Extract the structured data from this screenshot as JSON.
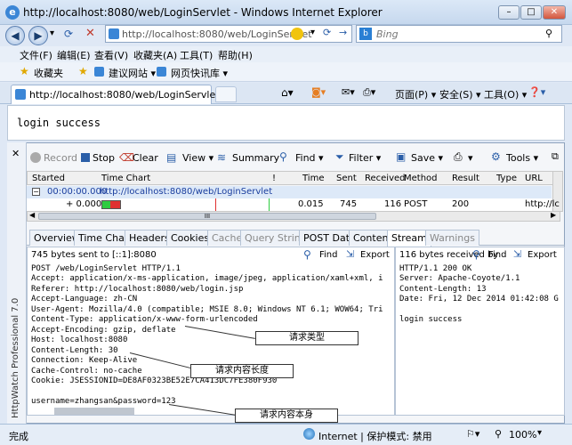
{
  "window": {
    "title": "http://localhost:8080/web/LoginServlet - Windows Internet Explorer",
    "min": "–",
    "max": "□",
    "close": "✕"
  },
  "address": {
    "url": "http://localhost:8080/web/LoginServlet",
    "search_placeholder": "Bing"
  },
  "menu": [
    "文件(F)",
    "编辑(E)",
    "查看(V)",
    "收藏夹(A)",
    "工具(T)",
    "帮助(H)"
  ],
  "favbar": {
    "favorites": "收藏夹",
    "suggested": "建议网站 ▾",
    "gallery": "网页快讯库 ▾"
  },
  "tab": {
    "title": "http://localhost:8080/web/LoginServlet"
  },
  "commandbar": {
    "page": "页面(P) ▾",
    "safety": "安全(S) ▾",
    "tools": "工具(O) ▾",
    "help": "❓▾"
  },
  "page_content": "login success",
  "httpwatch": {
    "vertical_label": "HttpWatch Professional 7.0",
    "toolbar": {
      "record": "Record",
      "stop": "Stop",
      "clear": "Clear",
      "view": "View ▾",
      "summary": "Summary",
      "find": "Find ▾",
      "filter": "Filter ▾",
      "save": "Save ▾",
      "print": "▾",
      "tools": "Tools ▾"
    },
    "columns": [
      "Started",
      "Time Chart",
      "!",
      "Time",
      "Sent",
      "Received",
      "Method",
      "Result",
      "Type",
      "URL"
    ],
    "rows": [
      {
        "started": "00:00:00.000",
        "url": "http://localhost:8080/web/LoginServlet"
      },
      {
        "started": "+ 0.000",
        "time": "0.015",
        "sent": "745",
        "received": "116",
        "method": "POST",
        "result": "200",
        "url": "http://lc"
      }
    ],
    "scroll_glyph": "III",
    "detail_tabs": [
      "Overview",
      "Time Chart",
      "Headers",
      "Cookies",
      "Cache",
      "Query String",
      "POST Data",
      "Content",
      "Stream",
      "Warnings"
    ],
    "left_pane": {
      "summary": "745 bytes sent to [::1]:8080",
      "find": "Find",
      "export": "Export",
      "lines": [
        "POST /web/LoginServlet HTTP/1.1",
        "Accept: application/x-ms-application, image/jpeg, application/xaml+xml, i",
        "Referer: http://localhost:8080/web/login.jsp",
        "Accept-Language: zh-CN",
        "User-Agent: Mozilla/4.0 (compatible; MSIE 8.0; Windows NT 6.1; WOW64; Tri",
        "Content-Type: application/x-www-form-urlencoded",
        "Accept-Encoding: gzip, deflate",
        "Host: localhost:8080",
        "Content-Length: 30",
        "Connection: Keep-Alive",
        "Cache-Control: no-cache",
        "Cookie: JSESSIONID=DE8AF0323BE52E7CA413DC7FE380F930",
        "",
        "username=zhangsan&password=123"
      ]
    },
    "right_pane": {
      "summary": "116 bytes received by",
      "find": "Find",
      "export": "Export",
      "lines": [
        "HTTP/1.1 200 OK",
        "Server: Apache-Coyote/1.1",
        "Content-Length: 13",
        "Date: Fri, 12 Dec 2014 01:42:08 G",
        "",
        "login success"
      ]
    },
    "callouts": [
      "请求类型",
      "请求内容长度",
      "请求内容本身"
    ]
  },
  "status": {
    "left": "完成",
    "zone": "Internet | 保护模式: 禁用",
    "zoom": "100%"
  }
}
